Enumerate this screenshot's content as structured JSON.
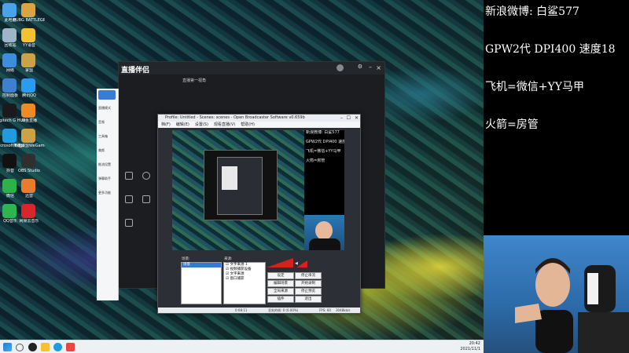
{
  "desktop": {
    "icons": [
      {
        "label": "此电脑",
        "icon": "computer-icon",
        "color": "#4aa3e8"
      },
      {
        "label": "PUBG BATTLEGR…",
        "icon": "pubg-icon",
        "color": "#d9a441"
      },
      {
        "label": "回收站",
        "icon": "recycle-bin-icon",
        "color": "#9fb4c6"
      },
      {
        "label": "YY语音",
        "icon": "yy-icon",
        "color": "#f2c230"
      },
      {
        "label": "网络",
        "icon": "network-icon",
        "color": "#3c8edc"
      },
      {
        "label": "掌盟",
        "icon": "league-icon",
        "color": "#caa24a"
      },
      {
        "label": "控制面板",
        "icon": "control-panel-icon",
        "color": "#3f7fd0"
      },
      {
        "label": "腾讯QQ",
        "icon": "qq-icon",
        "color": "#2b9bf0"
      },
      {
        "label": "Logitech G HUB",
        "icon": "logitech-icon",
        "color": "#1a1a1a"
      },
      {
        "label": "斗鱼直播",
        "icon": "douyu-icon",
        "color": "#f08a24"
      },
      {
        "label": "Microsoft Edge",
        "icon": "edge-icon",
        "color": "#1f9be0"
      },
      {
        "label": "英雄联盟WeGame版",
        "icon": "wegame-icon",
        "color": "#c9a447"
      },
      {
        "label": "抖音",
        "icon": "douyin-icon",
        "color": "#111111"
      },
      {
        "label": "OBS Studio",
        "icon": "obs-icon",
        "color": "#302e31"
      },
      {
        "label": "微信",
        "icon": "wechat-icon",
        "color": "#2db24a"
      },
      {
        "label": "迅雷",
        "icon": "xunlei-icon",
        "color": "#e87b2c"
      },
      {
        "label": "QQ音乐",
        "icon": "qqmusic-icon",
        "color": "#2fb452"
      },
      {
        "label": "网易云音乐",
        "icon": "netease-music-icon",
        "color": "#d8262c"
      }
    ]
  },
  "taskbar": {
    "time": "20:42",
    "date": "2021/11/1"
  },
  "streamer_app": {
    "logo": "直播伴侣",
    "tabs_line": "直播第一视角",
    "side_menu": [
      "直播模式",
      "音频",
      "工具箱",
      "美颜",
      "推流设置",
      "弹幕助手",
      "更多功能"
    ]
  },
  "obs": {
    "title": "Profile: Untitled - Scenes: scenes - Open Broadcaster Software v0.659b",
    "menu": [
      "档(F)",
      "编辑(E)",
      "设置(S)",
      "观看直播(V)",
      "帮助(H)"
    ],
    "preview_text": "新浪微博: 白鲨577\n\nGPW2代 DPI400 速度18\n\n飞机=微信+YY马甲\n\n火箭=房管",
    "scenes_header": "场景:",
    "scenes": [
      "场景"
    ],
    "sources_header": "来源:",
    "sources": [
      "文字来源 1",
      "视频捕获设备",
      "文字来源",
      "窗口捕获"
    ],
    "buttons": [
      "设定",
      "停止串流",
      "编辑场景",
      "开始录制",
      "全局来源",
      "停止预览",
      "插件",
      "退出"
    ],
    "status": {
      "time": "0:08:11",
      "dropped": "丢失的帧: 0 (0.00%)",
      "fps": "FPS: 60",
      "bitrate": "3048kb/s"
    }
  },
  "overlay_text": {
    "line1": "新浪微博: 白鲨577",
    "line2": "GPW2代 DPI400 速度18",
    "line3": "飞机=微信+YY马甲",
    "line4": "火箭=房管"
  },
  "colors": {
    "obs_bg": "#2c2f35",
    "accent_red": "#d62020",
    "cam_bg": "#3f86cc"
  }
}
